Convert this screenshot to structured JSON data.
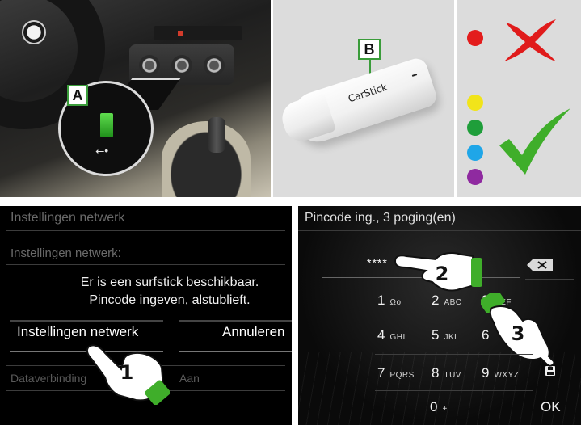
{
  "callouts": {
    "a": "A",
    "b": "B"
  },
  "stick": {
    "label": "CarStick"
  },
  "colors": {
    "red": "#e31c1c",
    "yellow": "#f1e41a",
    "green": "#1f9e3a",
    "blue": "#1fa6e8",
    "purple": "#8f2aa0",
    "cross": "#e01b1b",
    "check": "#3fae2a"
  },
  "network_screen": {
    "header": "Instellingen netwerk",
    "row_setting": "Instellingen netwerk:",
    "dialog_line1": "Er is een surfstick beschikbaar.",
    "dialog_line2": "Pincode ingeven, alstublieft.",
    "btn_settings": "Instellingen netwerk",
    "btn_cancel": "Annuleren",
    "row_data_label": "Dataverbinding",
    "row_data_value": "Aan"
  },
  "pin_screen": {
    "header": "Pincode ing., 3 poging(en)",
    "field_value": "****",
    "keys": [
      {
        "num": "1",
        "sub": "Ωο"
      },
      {
        "num": "2",
        "sub": "ABC"
      },
      {
        "num": "3",
        "sub": "DEF"
      },
      {
        "num": "4",
        "sub": "GHI"
      },
      {
        "num": "5",
        "sub": "JKL"
      },
      {
        "num": "6",
        "sub": ""
      },
      {
        "num": "7",
        "sub": "PQRS"
      },
      {
        "num": "8",
        "sub": "TUV"
      },
      {
        "num": "9",
        "sub": "WXYZ"
      },
      {
        "num": "0",
        "sub": "+"
      }
    ],
    "ok_label": "OK"
  },
  "steps": {
    "one": "1",
    "two": "2",
    "three": "3"
  }
}
